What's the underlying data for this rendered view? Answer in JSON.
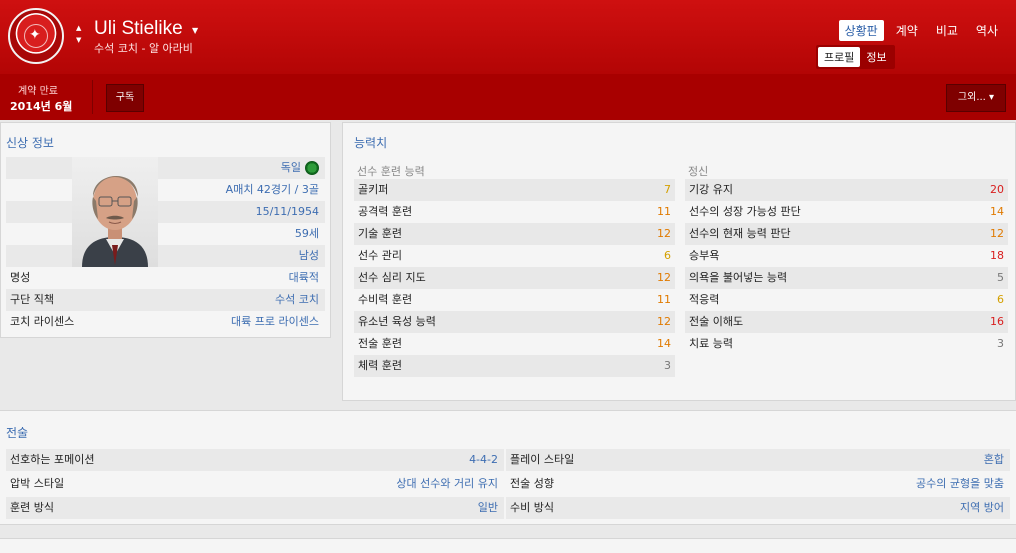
{
  "header": {
    "name": "Uli Stielike",
    "subtitle": "수석 코치 - 알 아라비",
    "nav": [
      "상황판",
      "계약",
      "비교",
      "역사"
    ],
    "subnav": [
      "프로필",
      "정보"
    ]
  },
  "bar": {
    "contract_label": "계약 만료",
    "contract_date": "2014년 6월",
    "subscribe": "구독",
    "more": "그외..."
  },
  "profile": {
    "title": "신상 정보",
    "nationality": "독일",
    "caps": "A매치 42경기 / 3골",
    "dob": "15/11/1954",
    "age": "59세",
    "gender": "남성",
    "rows": [
      {
        "label": "명성",
        "value": "대륙적"
      },
      {
        "label": "구단 직책",
        "value": "수석 코치"
      },
      {
        "label": "코치 라이센스",
        "value": "대륙 프로 라이센스"
      }
    ]
  },
  "attributes": {
    "title": "능력치",
    "coaching": {
      "heading": "선수 훈련 능력",
      "items": [
        {
          "label": "골키퍼",
          "value": "7",
          "color": "#d4a000"
        },
        {
          "label": "공격력 훈련",
          "value": "11",
          "color": "#e07a00"
        },
        {
          "label": "기술 훈련",
          "value": "12",
          "color": "#e07a00"
        },
        {
          "label": "선수 관리",
          "value": "6",
          "color": "#d4a000"
        },
        {
          "label": "선수 심리 지도",
          "value": "12",
          "color": "#e07a00"
        },
        {
          "label": "수비력 훈련",
          "value": "11",
          "color": "#e07a00"
        },
        {
          "label": "유소년 육성 능력",
          "value": "12",
          "color": "#e07a00"
        },
        {
          "label": "전술 훈련",
          "value": "14",
          "color": "#e07a00"
        },
        {
          "label": "체력 훈련",
          "value": "3",
          "color": "#777777"
        }
      ]
    },
    "mental": {
      "heading": "정신",
      "items": [
        {
          "label": "기강 유지",
          "value": "20",
          "color": "#d81e1e"
        },
        {
          "label": "선수의 성장 가능성 판단",
          "value": "14",
          "color": "#e07a00"
        },
        {
          "label": "선수의 현재 능력 판단",
          "value": "12",
          "color": "#e07a00"
        },
        {
          "label": "승부욕",
          "value": "18",
          "color": "#d81e1e"
        },
        {
          "label": "의욕을 불어넣는 능력",
          "value": "5",
          "color": "#777777"
        },
        {
          "label": "적응력",
          "value": "6",
          "color": "#d4a000"
        },
        {
          "label": "전술 이해도",
          "value": "16",
          "color": "#d81e1e"
        },
        {
          "label": "치료 능력",
          "value": "3",
          "color": "#777777"
        }
      ]
    }
  },
  "tactics": {
    "title": "전술",
    "rows": [
      {
        "l1": "선호하는 포메이션",
        "v1": "4-4-2",
        "l2": "플레이 스타일",
        "v2": "혼합"
      },
      {
        "l1": "압박 스타일",
        "v1": "상대 선수와 거리 유지",
        "l2": "전술 성향",
        "v2": "공수의 균형을 맞춤"
      },
      {
        "l1": "훈련 방식",
        "v1": "일반",
        "l2": "수비 방식",
        "v2": "지역 방어"
      }
    ]
  }
}
